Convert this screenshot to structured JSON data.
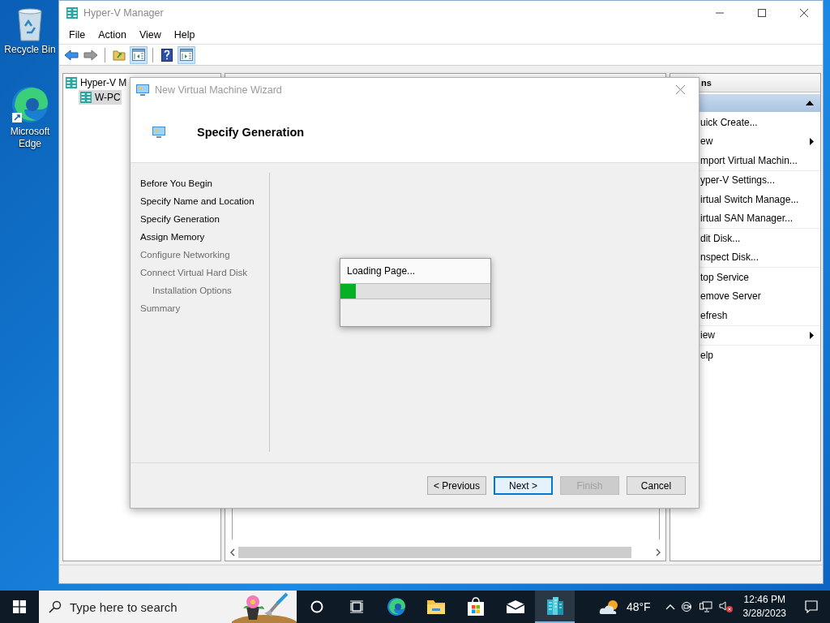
{
  "desktop_icons": [
    {
      "label": "Recycle Bin",
      "kind": "recycle"
    },
    {
      "label": "Microsoft Edge",
      "kind": "edge"
    }
  ],
  "main_window": {
    "title": "Hyper-V Manager",
    "menu": [
      "File",
      "Action",
      "View",
      "Help"
    ],
    "toolbar": [
      {
        "kind": "back",
        "pressed": false,
        "separator_after": false
      },
      {
        "kind": "forward",
        "pressed": false,
        "separator_after": true
      },
      {
        "kind": "up-folder",
        "pressed": false,
        "separator_after": false
      },
      {
        "kind": "tree-toggle",
        "pressed": true,
        "separator_after": true
      },
      {
        "kind": "help",
        "pressed": false,
        "separator_after": false
      },
      {
        "kind": "pane-toggle",
        "pressed": true,
        "separator_after": false
      }
    ],
    "tree": [
      {
        "label": "Hyper-V M",
        "selected": false,
        "children": [
          {
            "label": "W-PC",
            "selected": true
          }
        ]
      }
    ],
    "actions_header": "ns",
    "actions": [
      {
        "label": "uick Create...",
        "submenu": false,
        "separator_after": false
      },
      {
        "label": "ew",
        "submenu": true,
        "separator_after": false
      },
      {
        "label": "mport Virtual Machin...",
        "submenu": false,
        "separator_after": true
      },
      {
        "label": "yper-V Settings...",
        "submenu": false,
        "separator_after": false
      },
      {
        "label": "irtual Switch Manage...",
        "submenu": false,
        "separator_after": false
      },
      {
        "label": "irtual SAN Manager...",
        "submenu": false,
        "separator_after": true
      },
      {
        "label": "dit Disk...",
        "submenu": false,
        "separator_after": false
      },
      {
        "label": "nspect Disk...",
        "submenu": false,
        "separator_after": true
      },
      {
        "label": "top Service",
        "submenu": false,
        "separator_after": false
      },
      {
        "label": "emove Server",
        "submenu": false,
        "separator_after": false
      },
      {
        "label": "efresh",
        "submenu": false,
        "separator_after": true
      },
      {
        "label": "iew",
        "submenu": true,
        "separator_after": true
      },
      {
        "label": "elp",
        "submenu": false,
        "separator_after": false
      }
    ]
  },
  "wizard": {
    "title": "New Virtual Machine Wizard",
    "heading": "Specify Generation",
    "steps": [
      {
        "label": "Before You Begin",
        "enabled": true
      },
      {
        "label": "Specify Name and Location",
        "enabled": true
      },
      {
        "label": "Specify Generation",
        "enabled": true
      },
      {
        "label": "Assign Memory",
        "enabled": true
      },
      {
        "label": "Configure Networking",
        "enabled": false
      },
      {
        "label": "Connect Virtual Hard Disk",
        "enabled": false,
        "children": [
          {
            "label": "Installation Options",
            "enabled": false
          }
        ]
      },
      {
        "label": "Summary",
        "enabled": false
      }
    ],
    "buttons": [
      {
        "label": "< Previous",
        "default": false,
        "disabled": false
      },
      {
        "label": "Next >",
        "default": true,
        "disabled": false
      },
      {
        "label": "Finish",
        "default": false,
        "disabled": true
      },
      {
        "label": "Cancel",
        "default": false,
        "disabled": false
      }
    ]
  },
  "loading": {
    "message": "Loading Page...",
    "level": 0.1
  },
  "taskbar": {
    "search": {
      "placeholder": "Type here to search",
      "kind": "picture"
    },
    "apps": [
      {
        "kind": "cortana",
        "active": false
      },
      {
        "kind": "task-view",
        "active": false
      },
      {
        "kind": "edge",
        "active": false
      },
      {
        "kind": "file-explorer",
        "active": false
      },
      {
        "kind": "store",
        "active": false
      },
      {
        "kind": "mail",
        "active": false
      },
      {
        "kind": "hyper-v",
        "active": true
      }
    ],
    "weather": "48°F",
    "time": "12:46 PM",
    "date": "3/28/2023"
  }
}
